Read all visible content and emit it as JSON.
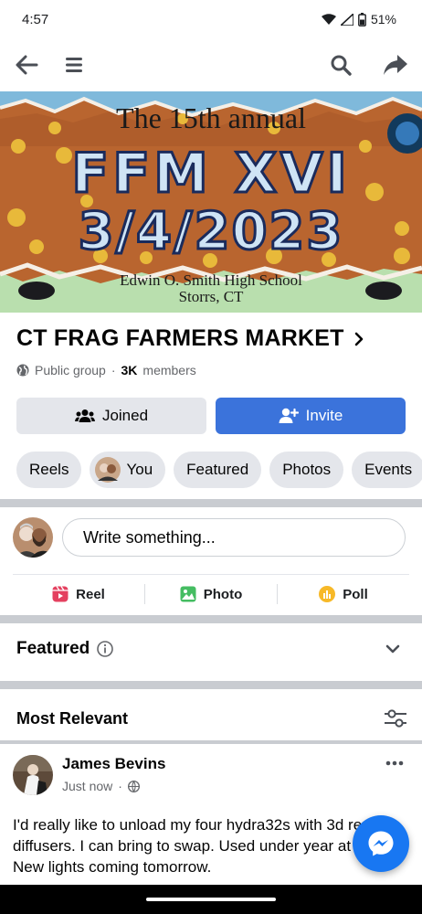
{
  "status_bar": {
    "time": "4:57",
    "battery": "51%"
  },
  "nav": {
    "icons": [
      "back-arrow-icon",
      "menu-icon",
      "search-icon",
      "share-icon"
    ]
  },
  "cover": {
    "line1": "The 15th annual",
    "line1_sup": "th",
    "headline": "FFM XVI",
    "date": "3/4/2023",
    "venue": "Edwin O. Smith High School",
    "town": "Storrs, CT"
  },
  "group": {
    "name": "CT FRAG FARMERS MARKET",
    "privacy": "Public group",
    "members_count": "3K",
    "members_suffix": "members",
    "dot": " · "
  },
  "actions": {
    "joined": "Joined",
    "invite": "Invite"
  },
  "chips": [
    "Reels",
    "You",
    "Featured",
    "Photos",
    "Events"
  ],
  "composer": {
    "placeholder": "Write something...",
    "reel": "Reel",
    "photo": "Photo",
    "poll": "Poll"
  },
  "featured": {
    "label": "Featured"
  },
  "feed": {
    "sort_label": "Most Relevant"
  },
  "post": {
    "author": "James Bevins",
    "time": "Just now",
    "text": "I'd really like to unload my four  hydra32s with 3d reefing diffusers. I can bring to swap.  Used under year at 50% . New lights coming tomorrow."
  },
  "colors": {
    "accent": "#3b73db",
    "fb_blue": "#1877f2",
    "grey_bg": "#e4e6eb"
  }
}
